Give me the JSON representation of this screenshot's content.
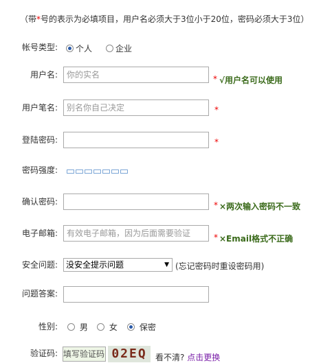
{
  "notice": {
    "prefix": "（带",
    "star": "*",
    "text": "号的表示为必填项目，用户名必须大于3位小于20位，密码必须大于3位）"
  },
  "account_type": {
    "label": "帐号类型:",
    "options": [
      "个人",
      "企业"
    ],
    "selected": "个人"
  },
  "username": {
    "label": "用户名:",
    "placeholder": "你的实名",
    "required_mark": "*",
    "status": "√用户名可以使用"
  },
  "nickname": {
    "label": "用户笔名:",
    "placeholder": "别名你自己决定",
    "required_mark": "*"
  },
  "password": {
    "label": "登陆密码:",
    "required_mark": "*"
  },
  "strength": {
    "label": "密码强度:",
    "segments": 7
  },
  "confirm": {
    "label": "确认密码:",
    "required_mark": "*",
    "error": "×两次输入密码不一致"
  },
  "email": {
    "label": "电子邮箱:",
    "placeholder": "有效电子邮箱，因为后面需要验证",
    "required_mark": "*",
    "error": "×Email格式不正确"
  },
  "security_question": {
    "label": "安全问题:",
    "selected": "没安全提示问题",
    "hint": "(忘记密码时重设密码用)"
  },
  "answer": {
    "label": "问题答案:"
  },
  "gender": {
    "label": "性别:",
    "options": [
      "男",
      "女",
      "保密"
    ],
    "selected": "保密"
  },
  "captcha": {
    "label": "验证码:",
    "placeholder": "填写验证码",
    "image_text": "02EQ",
    "unclear_text": "看不清?",
    "refresh_link": "点击更换"
  }
}
